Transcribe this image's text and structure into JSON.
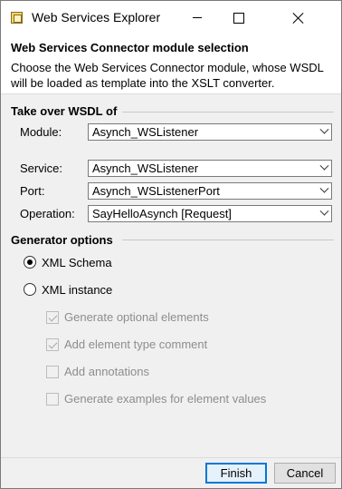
{
  "window": {
    "title": "Web Services Explorer"
  },
  "banner": {
    "title": "Web Services Connector module selection",
    "description": "Choose the Web Services Connector module, whose WSDL will be loaded as template into the XSLT converter."
  },
  "wsdl_section": {
    "title": "Take over WSDL of",
    "module_label": "Module:",
    "module_value": "Asynch_WSListener",
    "service_label": "Service:",
    "service_value": "Asynch_WSListener",
    "port_label": "Port:",
    "port_value": "Asynch_WSListenerPort",
    "operation_label": "Operation:",
    "operation_value": "SayHelloAsynch [Request]"
  },
  "generator_section": {
    "title": "Generator options",
    "radio_xml_schema": "XML Schema",
    "radio_xml_instance": "XML instance",
    "selected": "XML Schema",
    "options": [
      {
        "label": "Generate optional elements",
        "checked": true,
        "enabled": false
      },
      {
        "label": "Add element type comment",
        "checked": true,
        "enabled": false
      },
      {
        "label": "Add annotations",
        "checked": false,
        "enabled": false
      },
      {
        "label": "Generate examples for element values",
        "checked": false,
        "enabled": false
      }
    ]
  },
  "footer": {
    "finish_label": "Finish",
    "cancel_label": "Cancel"
  },
  "colors": {
    "default_button_border": "#0078d7",
    "window_bg": "#f0f0f0",
    "disabled_text": "#8d8d8d"
  }
}
